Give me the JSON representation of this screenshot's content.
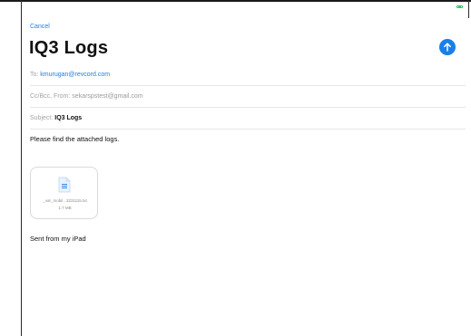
{
  "compose": {
    "cancel_label": "Cancel",
    "title": "IQ3 Logs",
    "to_label": "To:",
    "to_value": "kmurugan@revcord.com",
    "cc_label": "Cc/Bcc, From:",
    "cc_value": "sekarspstest@gmail.com",
    "subject_label": "Subject:",
    "subject_value": "IQ3 Logs",
    "body_text": "Please find the attached logs.",
    "signature": "Sent from my iPad"
  },
  "attachment": {
    "filename": "_var_mobil...3231115.txt",
    "size": "1.7 MB",
    "icon": "document-icon"
  },
  "colors": {
    "accent": "#1a7fe8",
    "battery": "#34c759"
  },
  "icons": {
    "send": "arrow-up-icon",
    "battery": "battery-icon"
  }
}
